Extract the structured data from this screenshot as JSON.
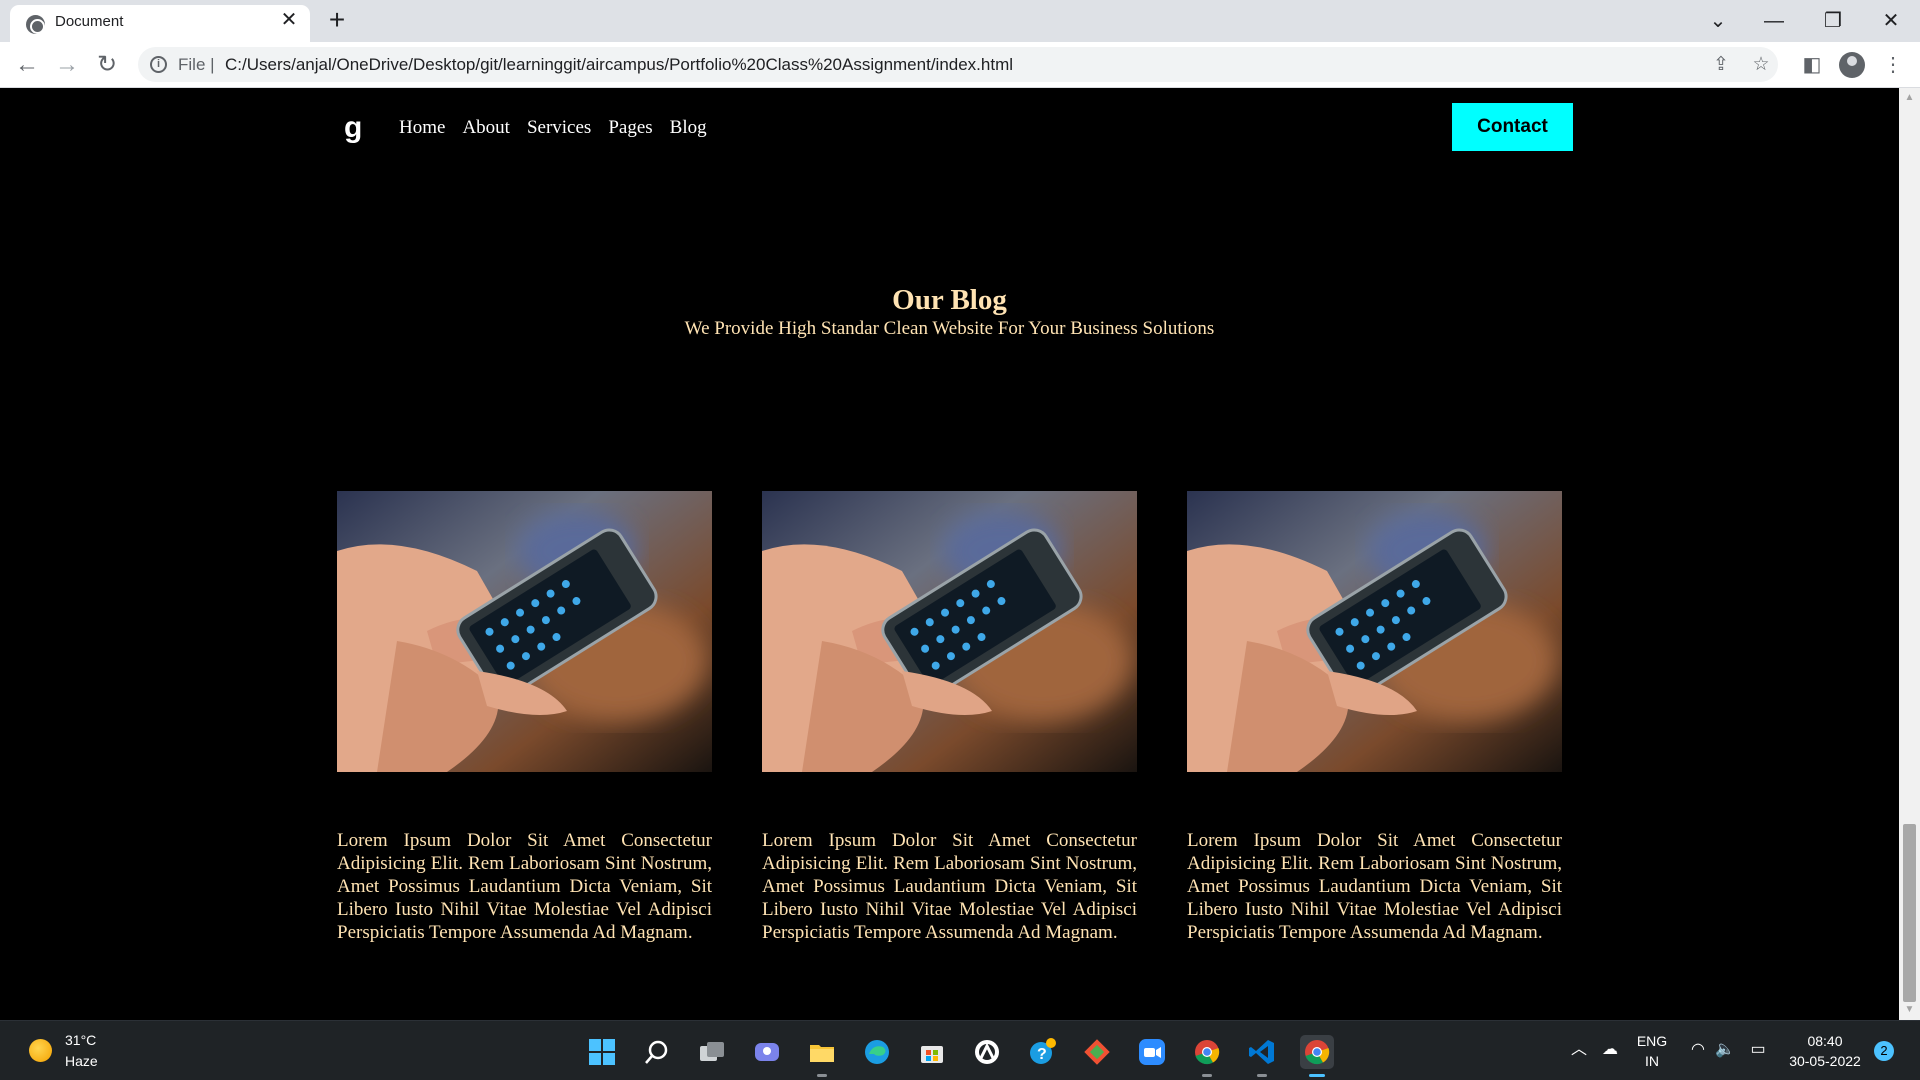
{
  "browser": {
    "tab_title": "Document",
    "tab_close": "✕",
    "new_tab": "+",
    "window_controls": [
      "⌄",
      "—",
      "❐",
      "✕"
    ],
    "nav": {
      "back": "←",
      "forward": "→",
      "reload": "↻"
    },
    "address": {
      "scheme": "File  |",
      "url": "C:/Users/anjal/OneDrive/Desktop/git/learninggit/aircampus/Portfolio%20Class%20Assignment/index.html"
    },
    "icons": [
      "share-icon",
      "bookmark-star-icon",
      "side-panel-icon",
      "profile-icon",
      "menu-icon"
    ]
  },
  "site": {
    "logo": "g",
    "nav": [
      "Home",
      "About",
      "Services",
      "Pages",
      "Blog"
    ],
    "contact_label": "Contact"
  },
  "blog": {
    "title": "Our Blog",
    "subtitle": "We Provide High Standar Clean Website For Your Business Solutions",
    "cards": [
      {
        "text": "Lorem Ipsum Dolor Sit Amet Consectetur Adipisicing Elit. Rem Laboriosam Sint Nostrum, Amet Possimus Laudantium Dicta Veniam, Sit Libero Iusto Nihil Vitae Molestiae Vel Adipisci Perspiciatis Tempore Assumenda Ad Magnam."
      },
      {
        "text": "Lorem Ipsum Dolor Sit Amet Consectetur Adipisicing Elit. Rem Laboriosam Sint Nostrum, Amet Possimus Laudantium Dicta Veniam, Sit Libero Iusto Nihil Vitae Molestiae Vel Adipisci Perspiciatis Tempore Assumenda Ad Magnam."
      },
      {
        "text": "Lorem Ipsum Dolor Sit Amet Consectetur Adipisicing Elit. Rem Laboriosam Sint Nostrum, Amet Possimus Laudantium Dicta Veniam, Sit Libero Iusto Nihil Vitae Molestiae Vel Adipisci Perspiciatis Tempore Assumenda Ad Magnam."
      }
    ]
  },
  "taskbar": {
    "weather": {
      "temp": "31°C",
      "condition": "Haze"
    },
    "apps": [
      "start-icon",
      "search-icon",
      "task-view-icon",
      "chat-icon",
      "file-explorer-icon",
      "edge-icon",
      "store-icon",
      "app-icon",
      "help-icon",
      "git-icon",
      "zoom-icon",
      "chrome-icon",
      "vscode-icon",
      "chrome-active-icon"
    ],
    "lang": {
      "line1": "ENG",
      "line2": "IN"
    },
    "clock": {
      "time": "08:40",
      "date": "30-05-2022"
    },
    "notifications": "2"
  }
}
